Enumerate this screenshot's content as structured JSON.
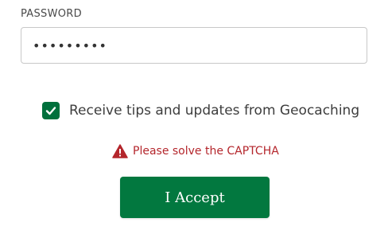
{
  "password": {
    "label": "PASSWORD",
    "value": "•••••••••"
  },
  "tips_checkbox": {
    "checked": true,
    "label": "Receive tips and updates from Geocaching"
  },
  "captcha_error": {
    "icon": "warning-triangle-icon",
    "message": "Please solve the CAPTCHA"
  },
  "accept_button": {
    "label": "I Accept"
  },
  "colors": {
    "brand_green": "#02783f",
    "error_red": "#b4262c"
  }
}
